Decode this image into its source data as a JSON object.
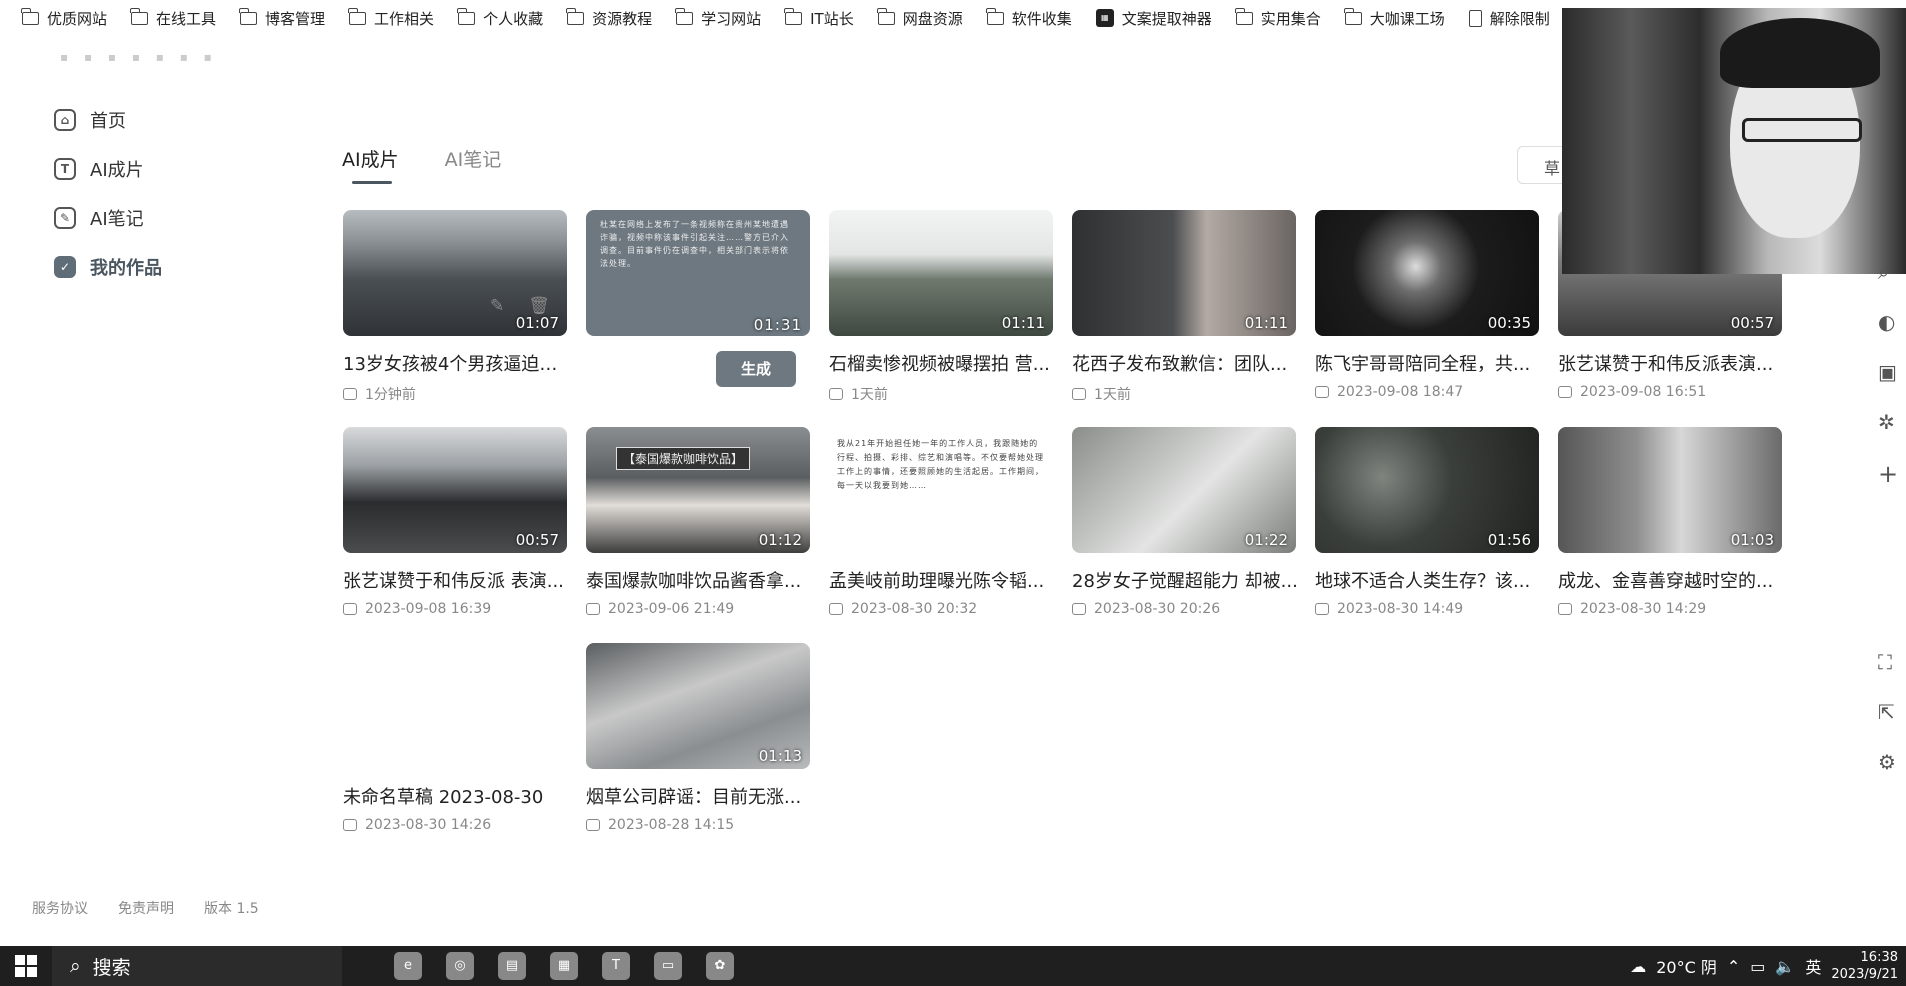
{
  "bookmarks": [
    {
      "label": "优质网站",
      "icon": "folder-icon"
    },
    {
      "label": "在线工具",
      "icon": "folder-icon"
    },
    {
      "label": "博客管理",
      "icon": "folder-icon"
    },
    {
      "label": "工作相关",
      "icon": "folder-icon"
    },
    {
      "label": "个人收藏",
      "icon": "folder-icon"
    },
    {
      "label": "资源教程",
      "icon": "folder-icon"
    },
    {
      "label": "学习网站",
      "icon": "folder-icon"
    },
    {
      "label": "IT站长",
      "icon": "folder-icon"
    },
    {
      "label": "网盘资源",
      "icon": "folder-icon"
    },
    {
      "label": "软件收集",
      "icon": "folder-icon"
    },
    {
      "label": "文案提取神器",
      "icon": "app-icon"
    },
    {
      "label": "实用集合",
      "icon": "folder-icon"
    },
    {
      "label": "大咖课工场",
      "icon": "folder-icon"
    },
    {
      "label": "解除限制",
      "icon": "document-icon"
    }
  ],
  "sidebar": {
    "items": [
      {
        "label": "首页",
        "icon": "home-icon",
        "glyph": "⌂"
      },
      {
        "label": "AI成片",
        "icon": "text-icon",
        "glyph": "T"
      },
      {
        "label": "AI笔记",
        "icon": "pen-icon",
        "glyph": "✎"
      },
      {
        "label": "我的作品",
        "icon": "check-icon",
        "glyph": "✓"
      }
    ]
  },
  "footer": {
    "terms": "服务协议",
    "disclaimer": "免责声明",
    "version": "版本 1.5"
  },
  "tabs": [
    {
      "label": "AI成片"
    },
    {
      "label": "AI笔记"
    }
  ],
  "draft_button": "草",
  "card_actions": {
    "generate": "生成"
  },
  "cards": [
    {
      "title": "13岁女孩被4个男孩逼迫喝酒",
      "meta": "1分钟前",
      "duration": "01:07",
      "thumb": "t-crowd"
    },
    {
      "title": "",
      "meta": "",
      "duration": "01:31",
      "thumb": "t-text",
      "overlay": "杜某在网络上发布了一条视频称在贵州某地遭遇诈骗，视频中称该事件引起关注……警方已介入调查。目前事件仍在调查中，相关部门表示将依法处理。"
    },
    {
      "title": "石榴卖惨视频被曝摆拍 营...",
      "meta": "1天前",
      "duration": "01:11",
      "thumb": "t-land"
    },
    {
      "title": "花西子发布致歉信：团队...",
      "meta": "1天前",
      "duration": "01:11",
      "thumb": "t-face"
    },
    {
      "title": "陈飞宇哥哥陪同全程，共...",
      "meta": "2023-09-08 18:47",
      "duration": "00:35",
      "thumb": "t-stage"
    },
    {
      "title": "张艺谋赞于和伟反派表演...",
      "meta": "2023-09-08 16:51",
      "duration": "00:57",
      "thumb": "t-drama"
    },
    {
      "title": "张艺谋赞于和伟反派 表演...",
      "meta": "2023-09-08 16:39",
      "duration": "00:57",
      "thumb": "t-man"
    },
    {
      "title": "泰国爆款咖啡饮品酱香拿...",
      "meta": "2023-09-06 21:49",
      "duration": "01:12",
      "thumb": "t-coffee",
      "overlay": "【泰国爆款咖啡饮品】"
    },
    {
      "title": "孟美岐前助理曝光陈令韬...",
      "meta": "2023-08-30 20:32",
      "duration": "",
      "thumb": "t-article",
      "overlay": "我从21年开始担任她一年的工作人员，我跟随她的行程、拍摄、彩排、综艺和演唱等。不仅要帮她处理工作上的事情，还要照顾她的生活起居。工作期间，每一天以我要到她……"
    },
    {
      "title": "28岁女子觉醒超能力 却被...",
      "meta": "2023-08-30 20:26",
      "duration": "01:22",
      "thumb": "t-road"
    },
    {
      "title": "地球不适合人类生存？该...",
      "meta": "2023-08-30 14:49",
      "duration": "01:56",
      "thumb": "t-plants"
    },
    {
      "title": "成龙、金喜善穿越时空的...",
      "meta": "2023-08-30 14:29",
      "duration": "01:03",
      "thumb": "t-woman"
    },
    {
      "title": "未命名草稿 2023-08-30",
      "meta": "2023-08-30 14:26",
      "duration": "",
      "thumb": "t-empty"
    },
    {
      "title": "烟草公司辟谣：目前无涨...",
      "meta": "2023-08-28 14:15",
      "duration": "01:13",
      "thumb": "t-tobacco"
    }
  ],
  "taskbar": {
    "search_label": "搜索",
    "apps": [
      {
        "icon": "browser-icon",
        "glyph": "e"
      },
      {
        "icon": "chrome-icon",
        "glyph": "◎"
      },
      {
        "icon": "notes-icon",
        "glyph": "▤"
      },
      {
        "icon": "gallery-icon",
        "glyph": "▦"
      },
      {
        "icon": "typora-icon",
        "glyph": "T"
      },
      {
        "icon": "folder-icon",
        "glyph": "▭"
      },
      {
        "icon": "flower-icon",
        "glyph": "✿"
      }
    ],
    "weather": "20°C 阴",
    "ime": "英",
    "time": "16:38",
    "date": "2023/9/21"
  }
}
